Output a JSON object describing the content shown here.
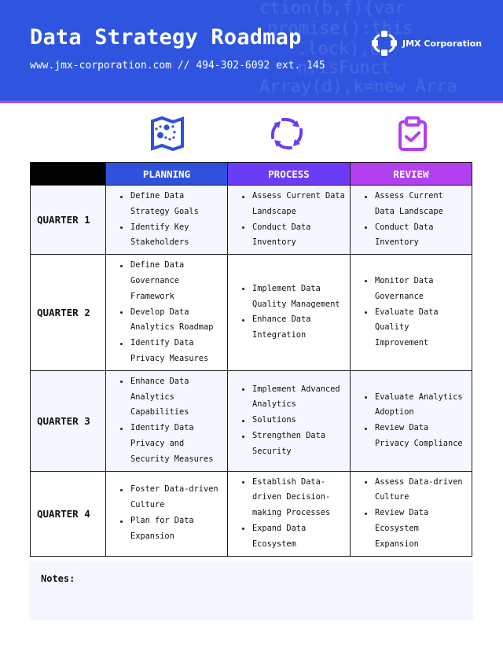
{
  "header": {
    "title": "Data Strategy Roadmap",
    "subtitle": "www.jmx-corporation.com // 494-302-6092 ext. 145",
    "company": "JMX Corporation",
    "background_code": [
      "ction(b,f){var",
      "promise():this",
      ".lock),e",
      "n.isFunct",
      "Array(d),k=new Arra"
    ]
  },
  "colors": {
    "header_bg": "#2f55e0",
    "accent_line": "#b046f0",
    "planning": "#2f52dc",
    "process": "#6a3cf5",
    "review": "#b23ff0",
    "row_alt": "#f4f7ff"
  },
  "icons": {
    "planning": "map-icon",
    "process": "cycle-arrows-icon",
    "review": "clipboard-check-icon"
  },
  "table": {
    "columns": [
      "PLANNING",
      "PROCESS",
      "REVIEW"
    ],
    "rows": [
      {
        "label": "QUARTER 1",
        "planning": [
          "Define Data Strategy Goals",
          "Identify Key Stakeholders"
        ],
        "process": [
          "Assess Current Data Landscape",
          "Conduct Data Inventory"
        ],
        "review": [
          "Assess Current Data Landscape",
          "Conduct Data Inventory"
        ]
      },
      {
        "label": "QUARTER 2",
        "planning": [
          "Define Data Governance Framework",
          "Develop Data Analytics Roadmap",
          "Identify Data Privacy Measures"
        ],
        "process": [
          "Implement Data Quality Management",
          "Enhance Data Integration"
        ],
        "review": [
          "Monitor Data Governance",
          "Evaluate Data Quality Improvement"
        ]
      },
      {
        "label": "QUARTER 3",
        "planning": [
          "Enhance Data Analytics Capabilities",
          "Identify Data Privacy and Security Measures"
        ],
        "process": [
          "Implement Advanced Analytics",
          "Solutions",
          "Strengthen Data Security"
        ],
        "review": [
          "Evaluate Analytics Adoption",
          "Review Data Privacy Compliance"
        ]
      },
      {
        "label": "QUARTER 4",
        "planning": [
          "Foster Data-driven Culture",
          "Plan for Data Expansion"
        ],
        "process": [
          "Establish Data-driven Decision-making Processes",
          "Expand Data Ecosystem"
        ],
        "review": [
          "Assess Data-driven Culture",
          "Review Data Ecosystem Expansion"
        ]
      }
    ]
  },
  "notes": {
    "label": "Notes:"
  }
}
